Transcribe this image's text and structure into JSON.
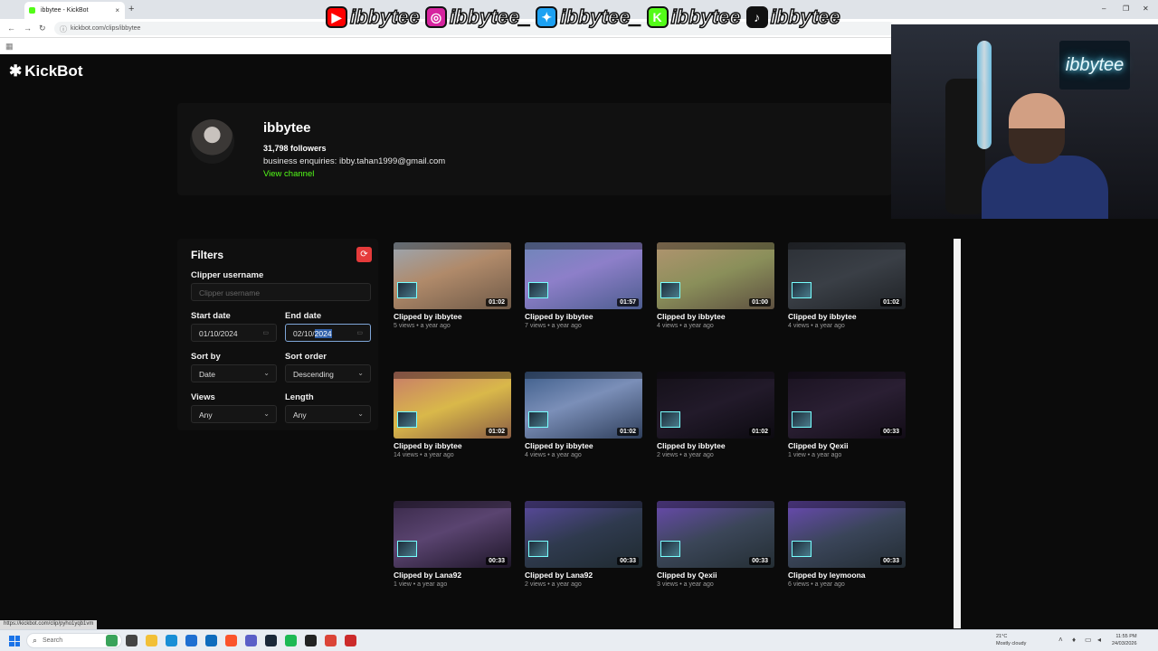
{
  "browser": {
    "tab_title": "ibbytee - KickBot",
    "new_tab": "+",
    "close_tab": "×",
    "url": "kickbot.com/clips/ibbytee",
    "status_link": "https://kickbot.com/clip/pyho1yqb1vm",
    "controls": {
      "minimize": "–",
      "restore": "❐",
      "close": "✕"
    },
    "nav": {
      "back": "←",
      "forward": "→",
      "reload": "↻",
      "secure": "ⓘ"
    },
    "apps_icon": "▦"
  },
  "overlay": {
    "socials": [
      {
        "icon": "youtube-icon",
        "glyph": "▶",
        "color": "#ff0000",
        "handle": "ibbytee"
      },
      {
        "icon": "instagram-icon",
        "glyph": "◎",
        "color": "#d6249f",
        "handle": "ibbytee_"
      },
      {
        "icon": "twitter-icon",
        "glyph": "✦",
        "color": "#1da1f2",
        "handle": "ibbytee_"
      },
      {
        "icon": "kick-icon",
        "glyph": "K",
        "color": "#53fc18",
        "handle": "ibbytee"
      },
      {
        "icon": "tiktok-icon",
        "glyph": "♪",
        "color": "#111111",
        "handle": "ibbytee"
      }
    ],
    "webcam_sign": "ibbytee"
  },
  "site": {
    "logo": "KickBot",
    "logo_mark": "✱",
    "accent": "#53fc18"
  },
  "profile": {
    "name": "ibbytee",
    "followers": "31,798 followers",
    "bio": "business enquiries: ibby.tahan1999@gmail.com",
    "link": "View channel"
  },
  "filters": {
    "title": "Filters",
    "reset_icon": "⟳",
    "clipper_label": "Clipper username",
    "clipper_placeholder": "Clipper username",
    "start_label": "Start date",
    "start_value": "01/10/2024",
    "end_label": "End date",
    "end_value_prefix": "02/10/",
    "end_value_selected": "2024",
    "sort_by_label": "Sort by",
    "sort_by_value": "Date",
    "sort_order_label": "Sort order",
    "sort_order_value": "Descending",
    "views_label": "Views",
    "views_value": "Any",
    "length_label": "Length",
    "length_value": "Any",
    "calendar_icon": "▭",
    "chevron": "⌄"
  },
  "clips": [
    {
      "duration": "01:02",
      "title": "Clipped by ibbytee",
      "meta": "5 views • a year ago",
      "bg": "linear-gradient(160deg,#9aa7b4 0%,#b08a6a 45%,#6f5a48 100%)"
    },
    {
      "duration": "01:57",
      "title": "Clipped by ibbytee",
      "meta": "7 views • a year ago",
      "bg": "linear-gradient(160deg,#6e86b8 0%,#8d7fc9 45%,#4d5d8f 100%)"
    },
    {
      "duration": "01:00",
      "title": "Clipped by ibbytee",
      "meta": "4 views • a year ago",
      "bg": "linear-gradient(160deg,#b29470 0%,#8a8f5a 50%,#5e5040 100%)"
    },
    {
      "duration": "01:02",
      "title": "Clipped by ibbytee",
      "meta": "4 views • a year ago",
      "bg": "linear-gradient(160deg,#2c3036 0%,#3a3f46 50%,#1f2226 100%)"
    },
    {
      "duration": "01:02",
      "title": "Clipped by ibbytee",
      "meta": "14 views • a year ago",
      "bg": "linear-gradient(160deg,#c77a6a 0%,#d9b84a 50%,#8a5d44 100%)"
    },
    {
      "duration": "01:02",
      "title": "Clipped by ibbytee",
      "meta": "4 views • a year ago",
      "bg": "linear-gradient(160deg,#3d5d8a 0%,#7b8fb8 45%,#2f3f5c 100%)"
    },
    {
      "duration": "01:02",
      "title": "Clipped by ibbytee",
      "meta": "2 views • a year ago",
      "bg": "linear-gradient(160deg,#141018 0%,#221a2a 50%,#0c0a10 100%)"
    },
    {
      "duration": "00:33",
      "title": "Clipped by Qexii",
      "meta": "1 view • a year ago",
      "bg": "linear-gradient(160deg,#1a1220 0%,#2a1f33 50%,#120c16 100%)"
    },
    {
      "duration": "00:33",
      "title": "Clipped by Lana92",
      "meta": "1 view • a year ago",
      "bg": "linear-gradient(160deg,#3a2a4a 0%,#5a4470 45%,#1e1628 100%)"
    },
    {
      "duration": "00:33",
      "title": "Clipped by Lana92",
      "meta": "2 views • a year ago",
      "bg": "linear-gradient(160deg,#5b4aa0 0%,#2f3a4e 50%,#1f2a30 100%)"
    },
    {
      "duration": "00:33",
      "title": "Clipped by Qexii",
      "meta": "3 views • a year ago",
      "bg": "linear-gradient(160deg,#6a4ab0 0%,#3b4658 50%,#242e34 100%)"
    },
    {
      "duration": "00:33",
      "title": "Clipped by leymoona",
      "meta": "6 views • a year ago",
      "bg": "linear-gradient(160deg,#6b4ab5 0%,#3a4559 50%,#232c33 100%)"
    }
  ],
  "taskbar": {
    "search_placeholder": "Search",
    "search_icon": "⌕",
    "weather_temp": "21°C",
    "weather_desc": "Mostly cloudy",
    "time": "11:55 PM",
    "date": "24/03/2026",
    "apps": [
      {
        "name": "taskbar-app-landscape",
        "color": "#3aa35a"
      },
      {
        "name": "taskbar-app-taskview",
        "color": "#444444"
      },
      {
        "name": "taskbar-app-explorer",
        "color": "#f2c037"
      },
      {
        "name": "taskbar-app-edge",
        "color": "#1a8fd6"
      },
      {
        "name": "taskbar-app-store",
        "color": "#1f6fd1"
      },
      {
        "name": "taskbar-app-outlook",
        "color": "#0f6cbd"
      },
      {
        "name": "taskbar-app-brave",
        "color": "#fb542b"
      },
      {
        "name": "taskbar-app-teams",
        "color": "#5b5fc7"
      },
      {
        "name": "taskbar-app-steam",
        "color": "#1b2838"
      },
      {
        "name": "taskbar-app-spotify",
        "color": "#1db954"
      },
      {
        "name": "taskbar-app-terminal",
        "color": "#222222"
      },
      {
        "name": "taskbar-app-chrome",
        "color": "#db4437"
      },
      {
        "name": "taskbar-app-obs",
        "color": "#cc2b2b"
      }
    ]
  }
}
